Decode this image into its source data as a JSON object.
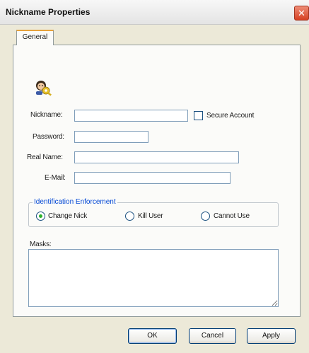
{
  "window": {
    "title": "Nickname Properties",
    "close_glyph": "✕"
  },
  "tabs": [
    {
      "label": "General",
      "selected": true
    }
  ],
  "icons": {
    "header_icon": "user-key-icon",
    "close": "close-icon"
  },
  "form": {
    "nickname": {
      "label": "Nickname:",
      "value": ""
    },
    "secure_account": {
      "label": "Secure Account",
      "checked": false
    },
    "password": {
      "label": "Password:",
      "value": ""
    },
    "real_name": {
      "label": "Real Name:",
      "value": ""
    },
    "email": {
      "label": "E-Mail:",
      "value": ""
    }
  },
  "identification": {
    "legend": "Identification Enforcement",
    "options": [
      {
        "label": "Change Nick",
        "selected": true
      },
      {
        "label": "Kill User",
        "selected": false
      },
      {
        "label": "Cannot Use",
        "selected": false
      }
    ]
  },
  "masks": {
    "label": "Masks:",
    "value": ""
  },
  "buttons": {
    "ok": "OK",
    "cancel": "Cancel",
    "apply": "Apply"
  },
  "colors": {
    "dialog_bg": "#ece9d8",
    "panel_bg": "#fbfbf9",
    "tab_accent": "#e6a23c",
    "close_button": "#d64022",
    "group_legend": "#0046d5",
    "radio_selected": "#2bb02b"
  }
}
